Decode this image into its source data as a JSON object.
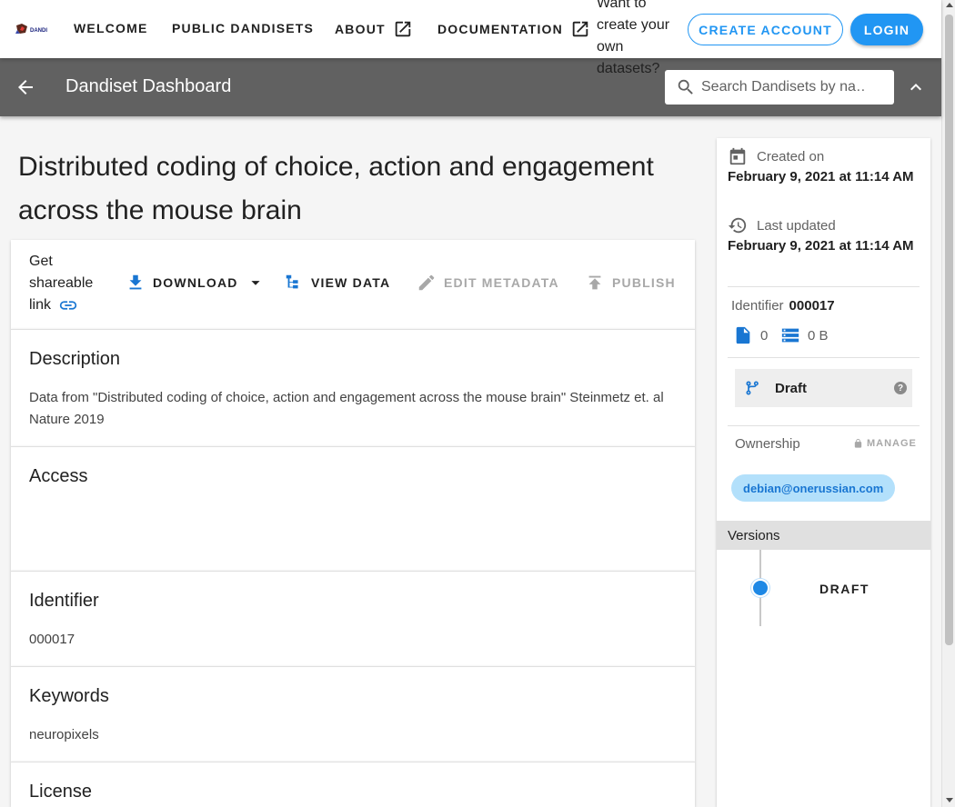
{
  "nav": {
    "links": [
      "WELCOME",
      "PUBLIC DANDISETS",
      "ABOUT",
      "DOCUMENTATION"
    ],
    "logo_text": "DANDI",
    "prompt": "Want to create your own datasets?",
    "create_account": "CREATE ACCOUNT",
    "login": "LOGIN"
  },
  "toolbar": {
    "title": "Dandiset Dashboard",
    "search_placeholder": "Search Dandisets by na…"
  },
  "dandiset": {
    "title": "Distributed coding of choice, action and engagement across the mouse brain",
    "share_label": "Get shareable link",
    "actions": {
      "download": "DOWNLOAD",
      "view_data": "VIEW DATA",
      "edit_metadata": "EDIT METADATA",
      "publish": "PUBLISH"
    },
    "sections": {
      "description_title": "Description",
      "description_body": "Data from \"Distributed coding of choice, action and engagement across the mouse brain\" Steinmetz et. al Nature 2019",
      "access_title": "Access",
      "identifier_title": "Identifier",
      "identifier_body": "000017",
      "keywords_title": "Keywords",
      "keywords_body": "neuropixels",
      "license_title": "License"
    }
  },
  "side": {
    "created_label": "Created on",
    "created_date": "February 9, 2021 at 11:14 AM",
    "updated_label": "Last updated",
    "updated_date": "February 9, 2021 at 11:14 AM",
    "identifier_label": "Identifier",
    "identifier_value": "000017",
    "file_count": "0",
    "size": "0 B",
    "draft_label": "Draft",
    "ownership_label": "Ownership",
    "manage_label": "MANAGE",
    "owner_email": "debian@onerussian.com",
    "versions_label": "Versions",
    "version_name": "DRAFT"
  },
  "colors": {
    "accent": "#2196f3",
    "toolbar": "#616161",
    "chip": "#b3e0fb"
  }
}
